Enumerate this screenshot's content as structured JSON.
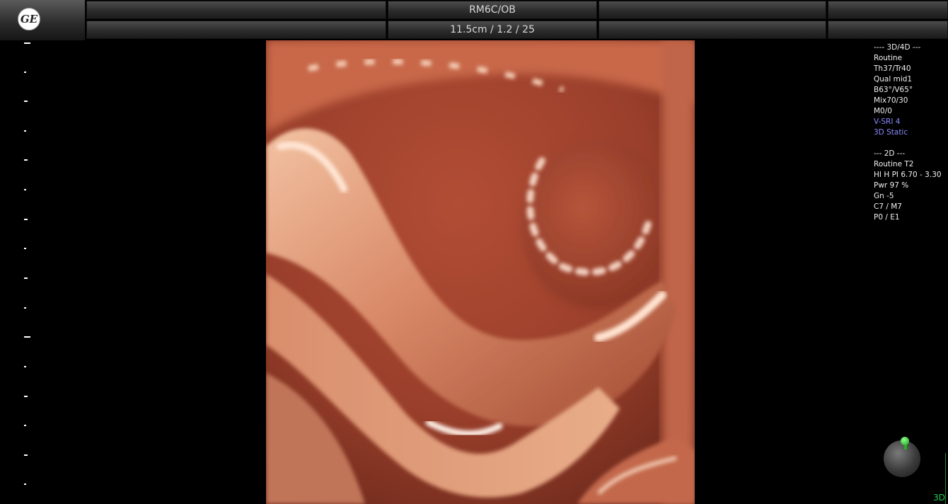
{
  "header": {
    "logo_text": "GE",
    "row1": [
      "",
      "RM6C/OB",
      "",
      ""
    ],
    "row2": [
      "",
      "11.5cm / 1.2 / 25",
      "",
      ""
    ]
  },
  "params": {
    "section_3d": "---- 3D/4D ---",
    "lines_3d": [
      "Routine",
      "Th37/Tr40",
      "Qual mid1",
      "B63°/V65°",
      "Mix70/30",
      "M0/0"
    ],
    "highlight_3d": [
      "V-SRI 4",
      "3D Static"
    ],
    "section_2d": "--- 2D ---",
    "lines_2d": [
      "Routine T2",
      "HI H PI 6.70 - 3.30",
      "Pwr  97 %",
      "Gn  -5",
      "C7 / M7",
      "P0 / E1"
    ]
  },
  "mode_label": "3D",
  "colors": {
    "highlight": "#8a8aff",
    "mode": "#1fcf4f",
    "tissue": "#b5553a"
  }
}
